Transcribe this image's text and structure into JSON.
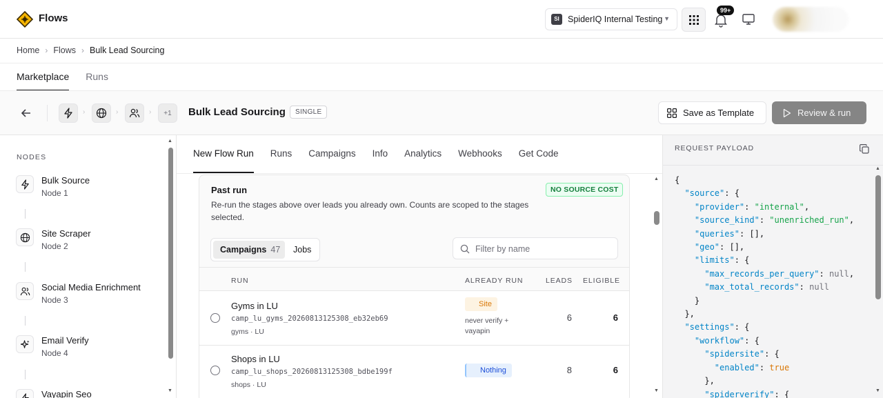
{
  "app": {
    "title": "Flows",
    "workspace": "SpiderIQ Internal Testing",
    "workspace_initials": "SI",
    "notifications_badge": "99+"
  },
  "breadcrumb": {
    "items": [
      "Home",
      "Flows"
    ],
    "current": "Bulk Lead Sourcing"
  },
  "page_tabs": [
    "Marketplace",
    "Runs"
  ],
  "flow": {
    "title": "Bulk Lead Sourcing",
    "mode_tag": "SINGLE",
    "extra_nodes": "+1",
    "save_template_label": "Save as Template",
    "review_run_label": "Review & run"
  },
  "sidebar": {
    "heading": "NODES",
    "nodes": [
      {
        "name": "Bulk Source",
        "sub": "Node 1",
        "icon": "bolt-icon"
      },
      {
        "name": "Site Scraper",
        "sub": "Node 2",
        "icon": "globe-icon"
      },
      {
        "name": "Social Media Enrichment",
        "sub": "Node 3",
        "icon": "users-icon"
      },
      {
        "name": "Email Verify",
        "sub": "Node 4",
        "icon": "sparkles-icon"
      },
      {
        "name": "Vayapin Seo",
        "sub": "",
        "icon": "bolt-icon"
      }
    ]
  },
  "sub_tabs": [
    "New Flow Run",
    "Runs",
    "Campaigns",
    "Info",
    "Analytics",
    "Webhooks",
    "Get Code"
  ],
  "past_run": {
    "title": "Past run",
    "description": "Re-run the stages above over leads you already own. Counts are scoped to the stages selected.",
    "cost_tag": "NO SOURCE COST",
    "segment": {
      "campaigns_label": "Campaigns",
      "campaigns_count": "47",
      "jobs_label": "Jobs"
    },
    "filter_placeholder": "Filter by name",
    "columns": {
      "run": "RUN",
      "already_run": "ALREADY RUN",
      "leads": "LEADS",
      "eligible": "ELIGIBLE"
    },
    "rows": [
      {
        "name": "Gyms in LU",
        "id": "camp_lu_gyms_20260813125308_eb32eb69",
        "meta": "gyms · LU",
        "already": "Site",
        "note_1": "never verify +",
        "note_2": "vayapin",
        "leads": "6",
        "eligible": "6"
      },
      {
        "name": "Shops in LU",
        "id": "camp_lu_shops_20260813125308_bdbe199f",
        "meta": "shops · LU",
        "already": "Nothing",
        "note_1": "",
        "note_2": "",
        "leads": "8",
        "eligible": "6"
      }
    ]
  },
  "payload": {
    "heading": "REQUEST PAYLOAD",
    "lines": [
      "{",
      "  \"source\": {",
      "    \"provider\": \"internal\",",
      "    \"source_kind\": \"unenriched_run\",",
      "    \"queries\": [],",
      "    \"geo\": [],",
      "    \"limits\": {",
      "      \"max_records_per_query\": null,",
      "      \"max_total_records\": null",
      "    }",
      "  },",
      "  \"settings\": {",
      "    \"workflow\": {",
      "      \"spidersite\": {",
      "        \"enabled\": true",
      "      },",
      "      \"spiderverify\": {"
    ]
  }
}
